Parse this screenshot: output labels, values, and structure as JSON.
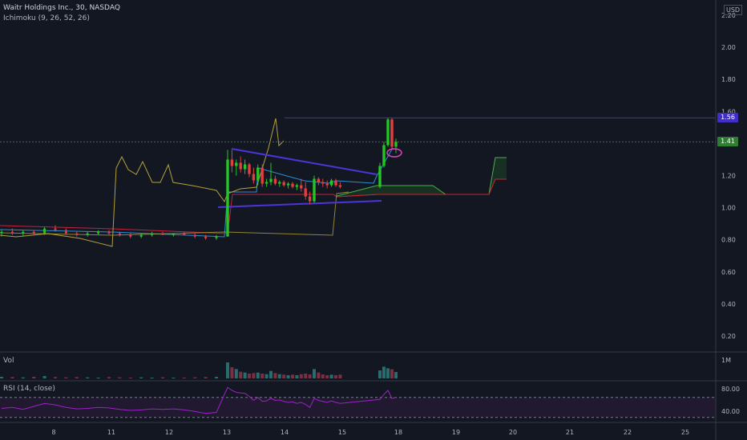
{
  "header": {
    "title": "Waitr Holdings Inc., 30, NASDAQ",
    "indicator": "Ichimoku (9, 26, 52, 26)"
  },
  "currency_label": "USD",
  "volume_pane": {
    "label": "Vol",
    "axis_tick": "1M"
  },
  "rsi_pane": {
    "label": "RSI (14, close)",
    "ticks": [
      "80.00",
      "40.00"
    ]
  },
  "price_tags": [
    {
      "label": "1.56",
      "value": 1.56,
      "color": "#3f2fc8",
      "text_color": "#ffffff"
    },
    {
      "label": "1.41",
      "value": 1.41,
      "color": "#2e7d32",
      "text_color": "#ffffff"
    }
  ],
  "colors": {
    "up": "#26c526",
    "down": "#e04040",
    "tenkan": "#2a8fd8",
    "kijun": "#c6223c",
    "chikou": "#b4a03a",
    "span_a": "#4caf50",
    "span_b": "#c62828",
    "trendline": "#4b35d8",
    "rsi": "#a020c8"
  },
  "chart_data": {
    "type": "candlestick",
    "title": "Waitr Holdings Inc., 30, NASDAQ",
    "x_ticks": [
      "8",
      "11",
      "12",
      "13",
      "14",
      "15",
      "18",
      "19",
      "20",
      "21",
      "22",
      "25"
    ],
    "y_ticks": [
      "2.20",
      "2.00",
      "1.80",
      "1.60",
      "1.40",
      "1.20",
      "1.00",
      "0.80",
      "0.60",
      "0.40",
      "0.20"
    ],
    "ylim": [
      0.1,
      2.25
    ],
    "grid": false,
    "horizontal_lines": [
      1.56,
      1.41
    ],
    "candles": [
      {
        "o": 0.84,
        "h": 0.86,
        "l": 0.82,
        "c": 0.85
      },
      {
        "o": 0.85,
        "h": 0.87,
        "l": 0.83,
        "c": 0.84
      },
      {
        "o": 0.84,
        "h": 0.86,
        "l": 0.82,
        "c": 0.85
      },
      {
        "o": 0.85,
        "h": 0.86,
        "l": 0.83,
        "c": 0.84
      },
      {
        "o": 0.84,
        "h": 0.88,
        "l": 0.83,
        "c": 0.87
      },
      {
        "o": 0.87,
        "h": 0.89,
        "l": 0.85,
        "c": 0.86
      },
      {
        "o": 0.86,
        "h": 0.87,
        "l": 0.83,
        "c": 0.84
      },
      {
        "o": 0.84,
        "h": 0.85,
        "l": 0.82,
        "c": 0.83
      },
      {
        "o": 0.83,
        "h": 0.85,
        "l": 0.82,
        "c": 0.84
      },
      {
        "o": 0.84,
        "h": 0.86,
        "l": 0.83,
        "c": 0.85
      },
      {
        "o": 0.85,
        "h": 0.86,
        "l": 0.83,
        "c": 0.84
      },
      {
        "o": 0.84,
        "h": 0.85,
        "l": 0.82,
        "c": 0.83
      },
      {
        "o": 0.83,
        "h": 0.84,
        "l": 0.81,
        "c": 0.82
      },
      {
        "o": 0.82,
        "h": 0.84,
        "l": 0.81,
        "c": 0.83
      },
      {
        "o": 0.83,
        "h": 0.85,
        "l": 0.82,
        "c": 0.84
      },
      {
        "o": 0.84,
        "h": 0.85,
        "l": 0.83,
        "c": 0.83
      },
      {
        "o": 0.83,
        "h": 0.84,
        "l": 0.82,
        "c": 0.84
      },
      {
        "o": 0.84,
        "h": 0.85,
        "l": 0.83,
        "c": 0.83
      },
      {
        "o": 0.83,
        "h": 0.84,
        "l": 0.81,
        "c": 0.82
      },
      {
        "o": 0.82,
        "h": 0.83,
        "l": 0.8,
        "c": 0.81
      },
      {
        "o": 0.81,
        "h": 0.83,
        "l": 0.8,
        "c": 0.82
      },
      {
        "o": 0.82,
        "h": 1.36,
        "l": 1.04,
        "c": 1.3
      },
      {
        "o": 1.3,
        "h": 1.36,
        "l": 1.22,
        "c": 1.26
      },
      {
        "o": 1.26,
        "h": 1.3,
        "l": 1.2,
        "c": 1.28
      },
      {
        "o": 1.28,
        "h": 1.32,
        "l": 1.22,
        "c": 1.24
      },
      {
        "o": 1.24,
        "h": 1.3,
        "l": 1.21,
        "c": 1.27
      },
      {
        "o": 1.27,
        "h": 1.28,
        "l": 1.19,
        "c": 1.21
      },
      {
        "o": 1.21,
        "h": 1.25,
        "l": 1.15,
        "c": 1.17
      },
      {
        "o": 1.17,
        "h": 1.27,
        "l": 1.14,
        "c": 1.25
      },
      {
        "o": 1.25,
        "h": 1.27,
        "l": 1.13,
        "c": 1.15
      },
      {
        "o": 1.15,
        "h": 1.18,
        "l": 1.13,
        "c": 1.16
      },
      {
        "o": 1.16,
        "h": 1.28,
        "l": 1.14,
        "c": 1.18
      },
      {
        "o": 1.18,
        "h": 1.2,
        "l": 1.14,
        "c": 1.15
      },
      {
        "o": 1.15,
        "h": 1.17,
        "l": 1.13,
        "c": 1.16
      },
      {
        "o": 1.16,
        "h": 1.17,
        "l": 1.13,
        "c": 1.14
      },
      {
        "o": 1.14,
        "h": 1.16,
        "l": 1.12,
        "c": 1.15
      },
      {
        "o": 1.15,
        "h": 1.16,
        "l": 1.12,
        "c": 1.13
      },
      {
        "o": 1.13,
        "h": 1.15,
        "l": 1.11,
        "c": 1.14
      },
      {
        "o": 1.14,
        "h": 1.18,
        "l": 1.1,
        "c": 1.12
      },
      {
        "o": 1.12,
        "h": 1.16,
        "l": 1.05,
        "c": 1.07
      },
      {
        "o": 1.07,
        "h": 1.1,
        "l": 1.02,
        "c": 1.04
      },
      {
        "o": 1.04,
        "h": 1.2,
        "l": 1.03,
        "c": 1.18
      },
      {
        "o": 1.18,
        "h": 1.19,
        "l": 1.14,
        "c": 1.16
      },
      {
        "o": 1.16,
        "h": 1.18,
        "l": 1.13,
        "c": 1.15
      },
      {
        "o": 1.15,
        "h": 1.17,
        "l": 1.12,
        "c": 1.14
      },
      {
        "o": 1.14,
        "h": 1.18,
        "l": 1.13,
        "c": 1.17
      },
      {
        "o": 1.17,
        "h": 1.18,
        "l": 1.13,
        "c": 1.14
      },
      {
        "o": 1.14,
        "h": 1.16,
        "l": 1.12,
        "c": 1.13
      },
      {
        "o": 1.13,
        "h": 1.28,
        "l": 1.12,
        "c": 1.26
      },
      {
        "o": 1.26,
        "h": 1.41,
        "l": 1.25,
        "c": 1.39
      },
      {
        "o": 1.39,
        "h": 1.56,
        "l": 1.38,
        "c": 1.55
      },
      {
        "o": 1.55,
        "h": 1.56,
        "l": 1.36,
        "c": 1.38
      },
      {
        "o": 1.38,
        "h": 1.43,
        "l": 1.34,
        "c": 1.41
      }
    ],
    "volume": [
      6,
      5,
      4,
      6,
      9,
      5,
      4,
      5,
      4,
      3,
      5,
      4,
      3,
      4,
      3,
      4,
      3,
      3,
      4,
      5,
      6,
      60,
      42,
      35,
      25,
      22,
      18,
      20,
      22,
      18,
      16,
      28,
      20,
      16,
      14,
      12,
      14,
      12,
      16,
      18,
      15,
      35,
      22,
      15,
      12,
      14,
      12,
      14,
      30,
      44,
      38,
      34,
      24
    ],
    "rsi": [
      48,
      50,
      46,
      52,
      58,
      55,
      50,
      47,
      48,
      50,
      49,
      46,
      44,
      45,
      47,
      46,
      47,
      45,
      42,
      38,
      40,
      90,
      84,
      80,
      79,
      78,
      72,
      64,
      70,
      62,
      63,
      68,
      64,
      65,
      62,
      60,
      61,
      58,
      60,
      56,
      50,
      68,
      64,
      62,
      60,
      63,
      60,
      58,
      66,
      76,
      84,
      68,
      70
    ]
  }
}
